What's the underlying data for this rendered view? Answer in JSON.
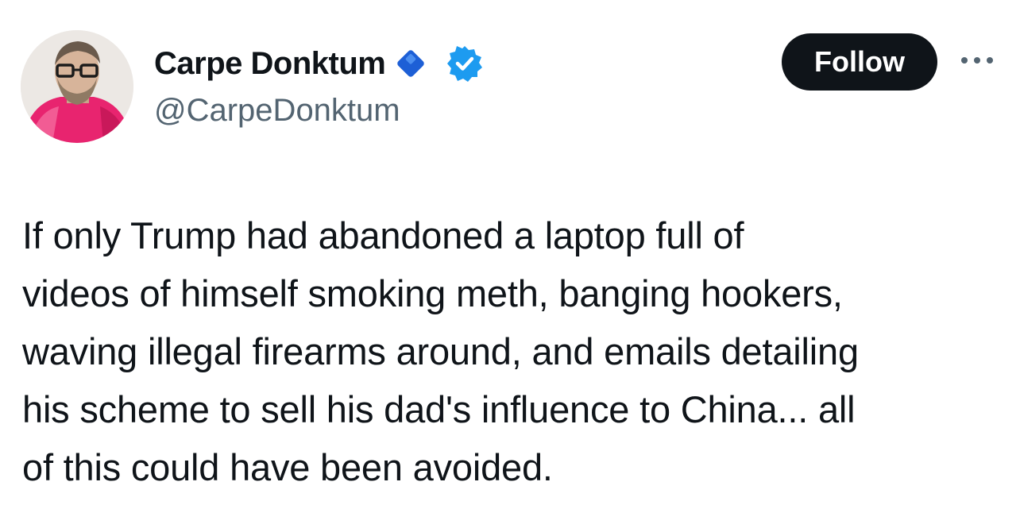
{
  "tweet": {
    "author": {
      "display_name": "Carpe Donktum",
      "handle": "@CarpeDonktum",
      "avatar_icon": "avatar-portrait",
      "badges": [
        "blue-diamond-icon",
        "verified-checkmark-icon"
      ]
    },
    "follow_label": "Follow",
    "more_icon": "more-dots-icon",
    "text": "If only Trump had abandoned a laptop full of\nvideos of himself smoking meth, banging hookers,\nwaving illegal firearms around, and emails detailing\nhis scheme to sell his dad's influence to China... all\nof this could have been avoided."
  },
  "colors": {
    "background": "#ffffff",
    "text_primary": "#0f1419",
    "text_secondary": "#536471",
    "follow_bg": "#0f1419",
    "follow_text": "#ffffff",
    "verified_blue": "#1d9bf0",
    "diamond_blue": "#1d5fd6"
  }
}
